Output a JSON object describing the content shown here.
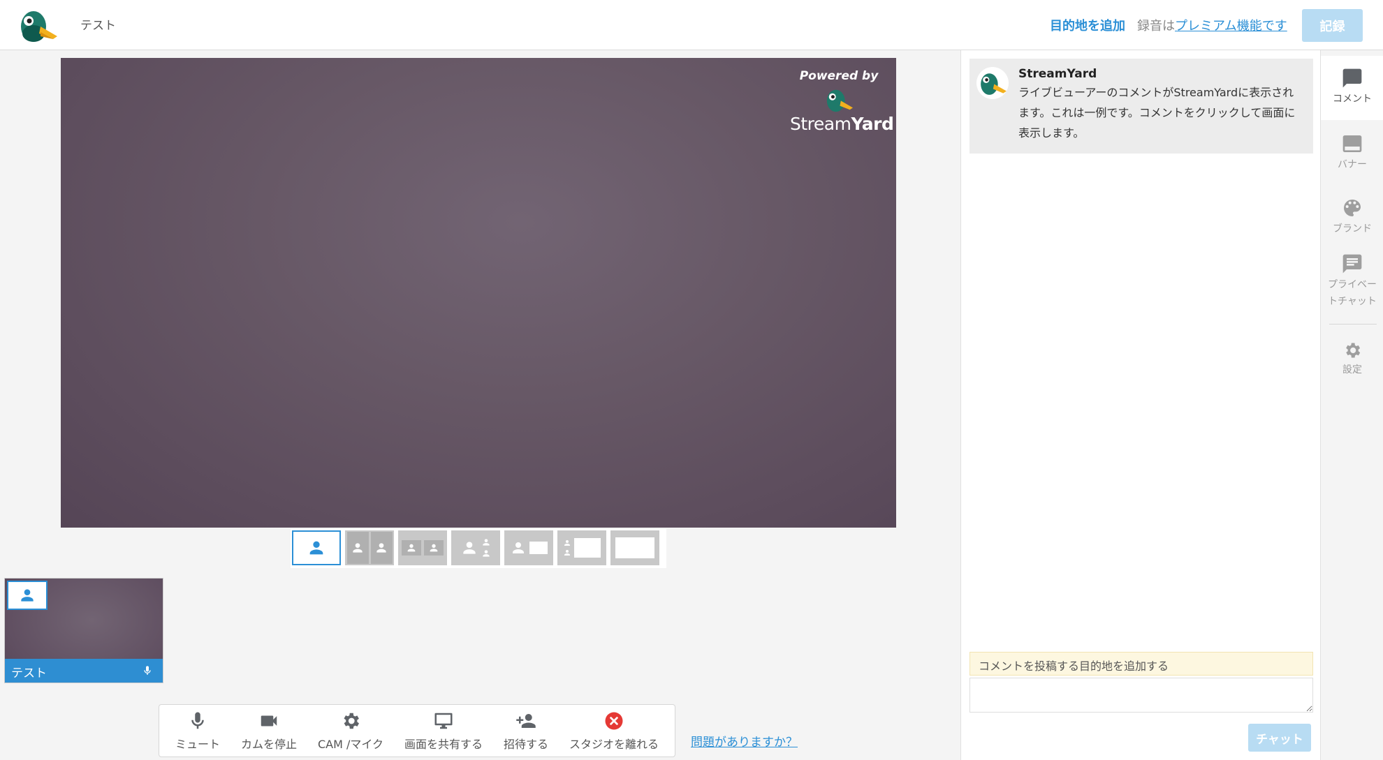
{
  "header": {
    "broadcast_title": "テスト",
    "add_destination": "目的地を追加",
    "recording_note_prefix": "録音は",
    "recording_note_link": "プレミアム機能です",
    "record_button": "記録"
  },
  "stage": {
    "powered_by": "Powered by",
    "brand_part1": "Stream",
    "brand_part2": "Yard"
  },
  "layouts": [
    {
      "id": "solo"
    },
    {
      "id": "two-split"
    },
    {
      "id": "two-group"
    },
    {
      "id": "leader"
    },
    {
      "id": "screen-side"
    },
    {
      "id": "screen-thumbs"
    },
    {
      "id": "fullscreen"
    }
  ],
  "participant": {
    "name": "テスト"
  },
  "controls": {
    "mute": "ミュート",
    "stop_cam": "カムを停止",
    "cam_mic": "CAM /マイク",
    "share_screen": "画面を共有する",
    "invite": "招待する",
    "leave": "スタジオを離れる"
  },
  "help_link": "問題がありますか？",
  "comments": {
    "items": [
      {
        "author": "StreamYard",
        "text": "ライブビューアーのコメントがStreamYardに表示されます。これは一例です。コメントをクリックして画面に表示します。"
      }
    ],
    "notice": "コメントを投稿する目的地を追加する",
    "send_button": "チャット"
  },
  "rail": {
    "comments": "コメント",
    "banners": "バナー",
    "brand": "ブランド",
    "private_chat": "プライベートチャット",
    "settings": "設定"
  },
  "colors": {
    "accent": "#2b8fd6",
    "accent_light": "#b8dcf3",
    "danger": "#e53935"
  }
}
